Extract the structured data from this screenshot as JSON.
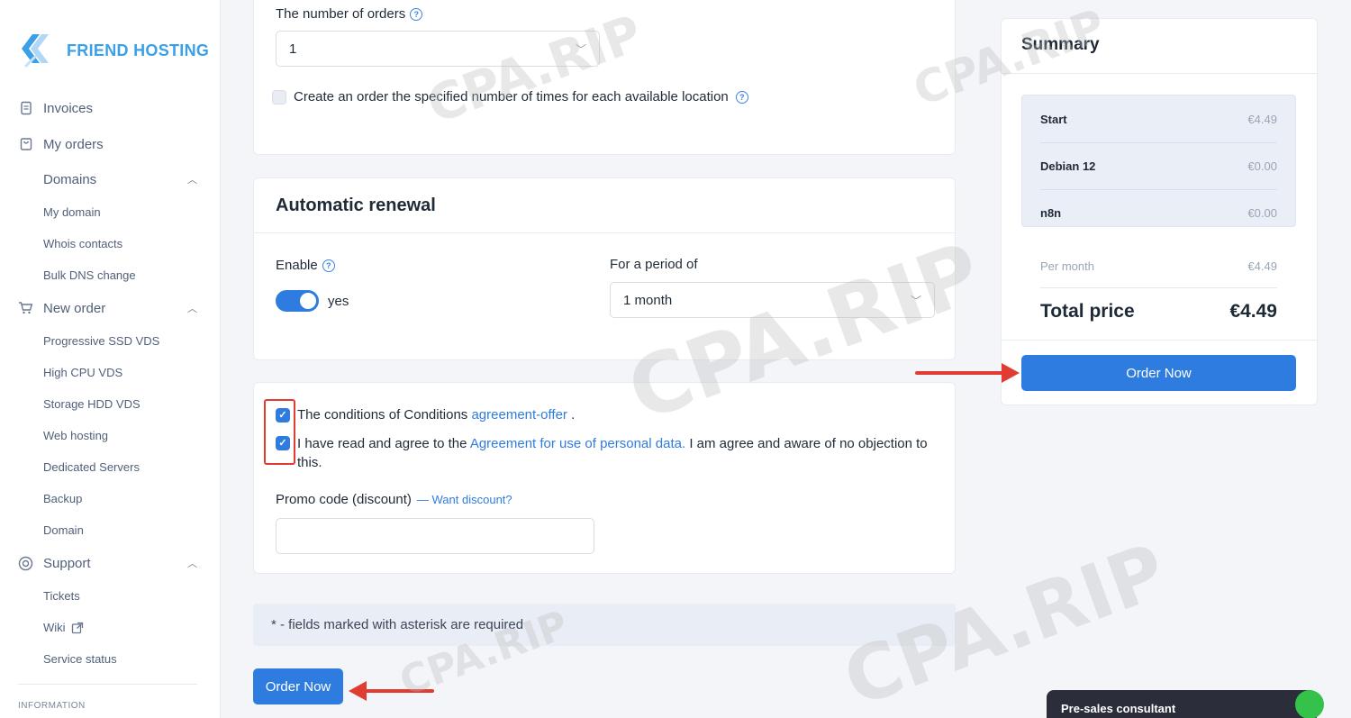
{
  "brand": {
    "name": "FRIEND HOSTING"
  },
  "sidebar": {
    "items": [
      {
        "label": "Invoices",
        "icon": "document-icon"
      },
      {
        "label": "My orders",
        "icon": "bag-icon"
      }
    ],
    "domains": {
      "label": "Domains",
      "sub": [
        "My domain",
        "Whois contacts",
        "Bulk DNS change"
      ]
    },
    "new_order": {
      "label": "New order",
      "icon": "cart-icon",
      "sub": [
        "Progressive SSD VDS",
        "High CPU VDS",
        "Storage HDD VDS",
        "Web hosting",
        "Dedicated Servers",
        "Backup",
        "Domain"
      ]
    },
    "support": {
      "label": "Support",
      "icon": "lifebuoy-icon",
      "sub": [
        "Tickets",
        "Wiki",
        "Service status"
      ]
    },
    "info_label": "INFORMATION"
  },
  "orders": {
    "count_label": "The number of orders",
    "count_value": "1",
    "each_location_label": "Create an order the specified number of times for each available location"
  },
  "renewal": {
    "title": "Automatic renewal",
    "enable_label": "Enable",
    "enable_value": "yes",
    "period_label": "For a period of",
    "period_value": "1 month"
  },
  "agreement": {
    "conditions_prefix": "The conditions of Conditions",
    "conditions_link": "agreement-offer",
    "conditions_suffix": ".",
    "personal_prefix": "I have read and agree to the",
    "personal_link": "Agreement for use of personal data.",
    "personal_suffix": "I am agree and aware of no objection to",
    "personal_suffix2": "this.",
    "promo_label": "Promo code (discount)",
    "promo_link": "— Want discount?",
    "promo_value": ""
  },
  "required_note": "* - fields marked with asterisk are required",
  "order_button": "Order Now",
  "summary": {
    "title": "Summary",
    "items": [
      {
        "name": "Start",
        "price": "€4.49"
      },
      {
        "name": "Debian 12",
        "price": "€0.00"
      },
      {
        "name": "n8n",
        "price": "€0.00"
      }
    ],
    "per_month_label": "Per month",
    "per_month_value": "€4.49",
    "total_label": "Total price",
    "total_value": "€4.49",
    "order_button": "Order Now"
  },
  "consultant": {
    "label": "Pre-sales consultant"
  },
  "watermark": "CPA.RIP",
  "colors": {
    "accent": "#2f7ce0",
    "brand": "#3ba0e6",
    "annotation": "#e03c31"
  }
}
